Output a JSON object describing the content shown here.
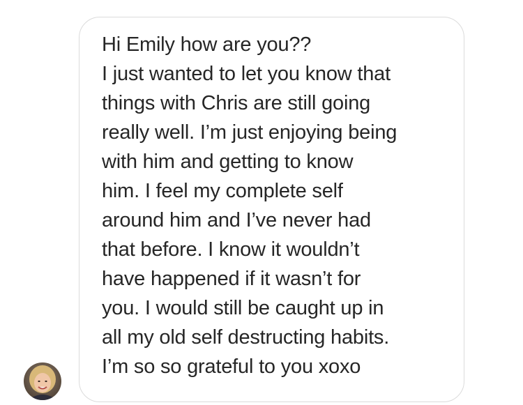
{
  "conversation": {
    "message": {
      "lines": [
        "Hi Emily how are you??",
        "I just wanted to let you know that",
        "things with Chris are still going",
        "really well. I’m just enjoying being",
        "with him and getting to know",
        "him. I feel my complete self",
        "around him and I’ve never had",
        "that before. I know it wouldn’t",
        "have happened if it wasn’t for",
        "you. I would still be caught up in",
        "all my old self destructing habits.",
        "I’m so so grateful to you xoxo"
      ]
    },
    "sender": {
      "avatar_icon": "profile-photo"
    }
  },
  "colors": {
    "bubble_border": "#dbdbdb",
    "text": "#262626",
    "background": "#ffffff"
  }
}
